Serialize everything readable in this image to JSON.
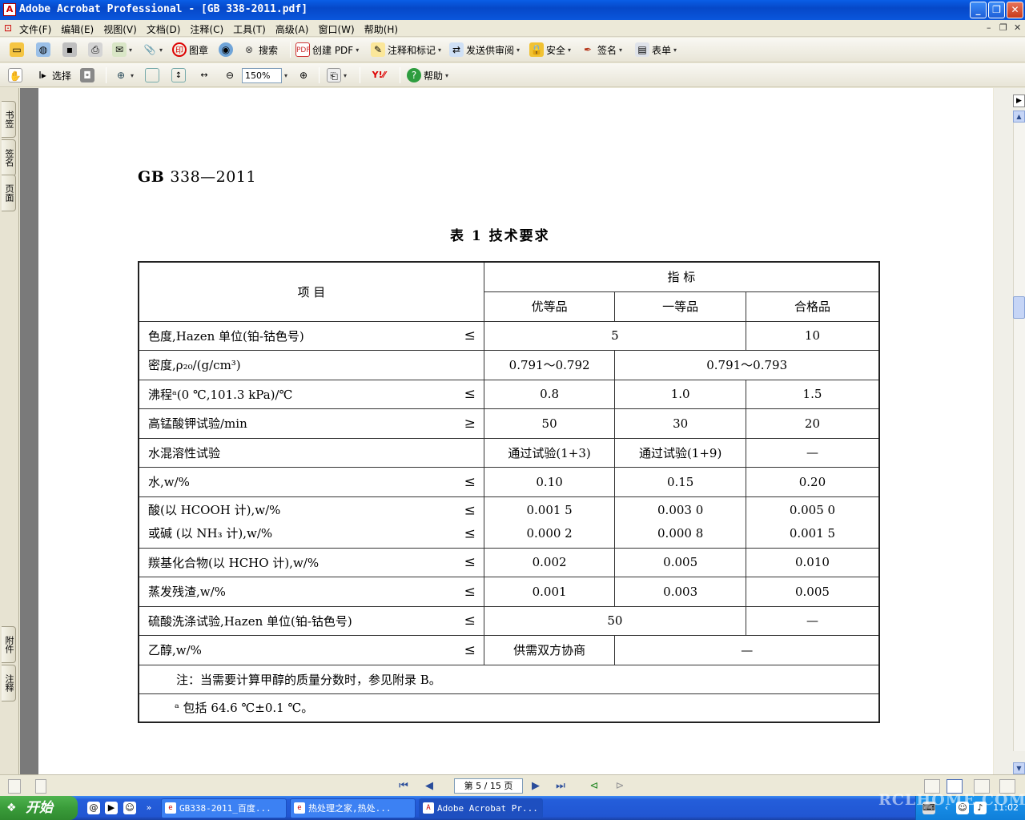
{
  "window": {
    "title": "Adobe Acrobat Professional - [GB 338-2011.pdf]"
  },
  "menu": [
    "文件(F)",
    "编辑(E)",
    "视图(V)",
    "文档(D)",
    "注释(C)",
    "工具(T)",
    "高级(A)",
    "窗口(W)",
    "帮助(H)"
  ],
  "toolbar1": {
    "stamp": "图章",
    "search": "搜索",
    "create_pdf": "创建 PDF",
    "comment_markup": "注释和标记",
    "send_review": "发送供审阅",
    "security": "安全",
    "sign": "签名",
    "forms": "表单"
  },
  "toolbar2": {
    "select": "选择",
    "zoom": "150%",
    "help": "帮助"
  },
  "nav_tabs": {
    "bookmarks": "书签",
    "signatures": "签名",
    "pages": "页面",
    "attachments": "附件",
    "comments": "注释"
  },
  "document": {
    "header": "GB",
    "header_num": "338—2011",
    "table_title": "表 1   技术要求",
    "col_item": "项      目",
    "col_index": "指      标",
    "grades": [
      "优等品",
      "一等品",
      "合格品"
    ],
    "rows": {
      "color": {
        "item": "色度,Hazen 单位(铂-钴色号)",
        "sym": "≤",
        "v12": "5",
        "v3": "10"
      },
      "density": {
        "item": "密度,ρ₂₀/(g/cm³)",
        "v1": "0.791～0.792",
        "v23": "0.791～0.793"
      },
      "boiling": {
        "item": "沸程ᵃ(0 ℃,101.3 kPa)/℃",
        "sym": "≤",
        "v1": "0.8",
        "v2": "1.0",
        "v3": "1.5"
      },
      "kmno4": {
        "item": "高锰酸钾试验/min",
        "sym": "≥",
        "v1": "50",
        "v2": "30",
        "v3": "20"
      },
      "miscibility": {
        "item": "水混溶性试验",
        "v1": "通过试验(1+3)",
        "v2": "通过试验(1+9)",
        "v3": "—"
      },
      "water": {
        "item": "水,w/%",
        "sym": "≤",
        "v1": "0.10",
        "v2": "0.15",
        "v3": "0.20"
      },
      "acid": {
        "item": "酸(以 HCOOH 计),w/%",
        "sym": "≤",
        "v1": "0.001 5",
        "v2": "0.003 0",
        "v3": "0.005 0"
      },
      "alkali": {
        "item": "或碱 (以 NH₃ 计),w/%",
        "sym": "≤",
        "v1": "0.000 2",
        "v2": "0.000 8",
        "v3": "0.001 5"
      },
      "carbonyl": {
        "item": "羰基化合物(以 HCHO 计),w/%",
        "sym": "≤",
        "v1": "0.002",
        "v2": "0.005",
        "v3": "0.010"
      },
      "residue": {
        "item": "蒸发残渣,w/%",
        "sym": "≤",
        "v1": "0.001",
        "v2": "0.003",
        "v3": "0.005"
      },
      "sulfuric": {
        "item": "硫酸洗涤试验,Hazen 单位(铂-钴色号)",
        "sym": "≤",
        "v12": "50",
        "v3": "—"
      },
      "ethanol": {
        "item": "乙醇,w/%",
        "sym": "≤",
        "v1": "供需双方协商",
        "v23": "—"
      }
    },
    "note1": "注：当需要计算甲醇的质量分数时，参见附录 B。",
    "note2": "ᵃ  包括 64.6 ℃±0.1 ℃。"
  },
  "status": {
    "page": "第 5 / 15 页"
  },
  "taskbar": {
    "start": "开始",
    "tasks": [
      "GB338-2011_百度...",
      "热处理之家,热处...",
      "Adobe Acrobat Pr..."
    ],
    "clock": "11:02",
    "watermark": "RCLHOME.COM"
  }
}
